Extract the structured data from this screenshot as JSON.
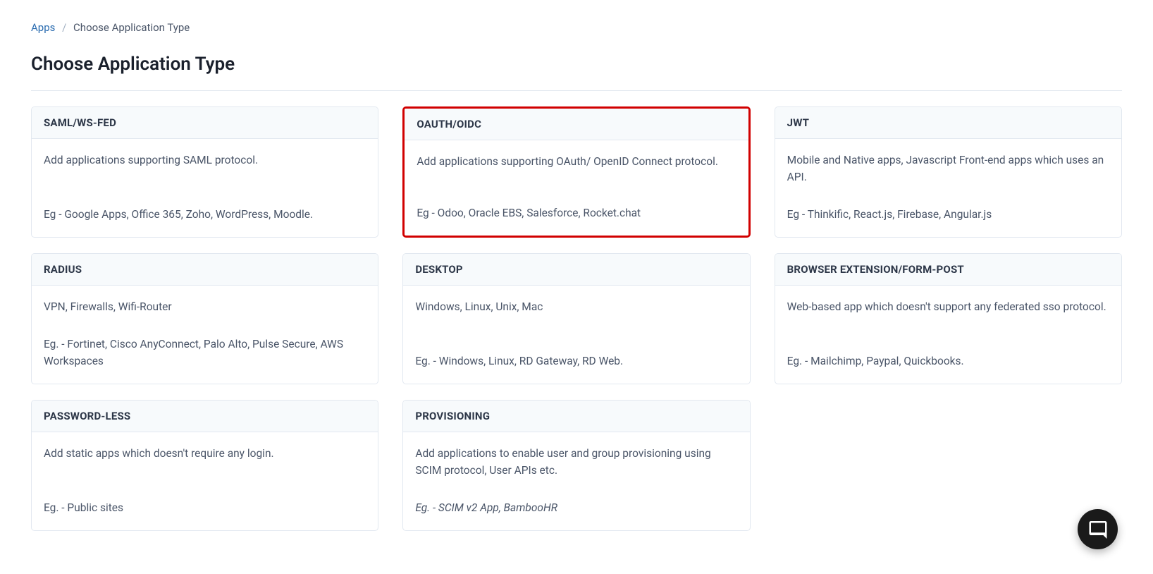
{
  "breadcrumb": {
    "parent": "Apps",
    "current": "Choose Application Type"
  },
  "page_title": "Choose Application Type",
  "cards": [
    {
      "title": "SAML/WS-FED",
      "description": "Add applications supporting SAML protocol.",
      "example": "Eg - Google Apps, Office 365, Zoho, WordPress, Moodle.",
      "highlighted": false,
      "name": "card-saml-wsfed"
    },
    {
      "title": "OAUTH/OIDC",
      "description": "Add applications supporting OAuth/ OpenID Connect protocol.",
      "example": "Eg - Odoo, Oracle EBS, Salesforce, Rocket.chat",
      "highlighted": true,
      "name": "card-oauth-oidc"
    },
    {
      "title": "JWT",
      "description": "Mobile and Native apps, Javascript Front-end apps which uses an API.",
      "example": "Eg - Thinkific, React.js, Firebase, Angular.js",
      "highlighted": false,
      "name": "card-jwt"
    },
    {
      "title": "RADIUS",
      "description": "VPN, Firewalls, Wifi-Router",
      "example": "Eg. - Fortinet, Cisco AnyConnect, Palo Alto, Pulse Secure, AWS Workspaces",
      "highlighted": false,
      "name": "card-radius"
    },
    {
      "title": "DESKTOP",
      "description": "Windows, Linux, Unix, Mac",
      "example": "Eg. - Windows, Linux, RD Gateway, RD Web.",
      "highlighted": false,
      "name": "card-desktop"
    },
    {
      "title": "BROWSER EXTENSION/FORM-POST",
      "description": "Web-based app which doesn't support any federated sso protocol.",
      "example": "Eg. - Mailchimp, Paypal, Quickbooks.",
      "highlighted": false,
      "name": "card-browser-extension"
    },
    {
      "title": "PASSWORD-LESS",
      "description": "Add static apps which doesn't require any login.",
      "example": "Eg. - Public sites",
      "highlighted": false,
      "name": "card-password-less"
    },
    {
      "title": "PROVISIONING",
      "description": "Add applications to enable user and group provisioning using SCIM protocol, User APIs etc.",
      "example": "Eg. - SCIM v2 App, BambooHR",
      "highlighted": false,
      "example_italic": true,
      "name": "card-provisioning"
    }
  ]
}
